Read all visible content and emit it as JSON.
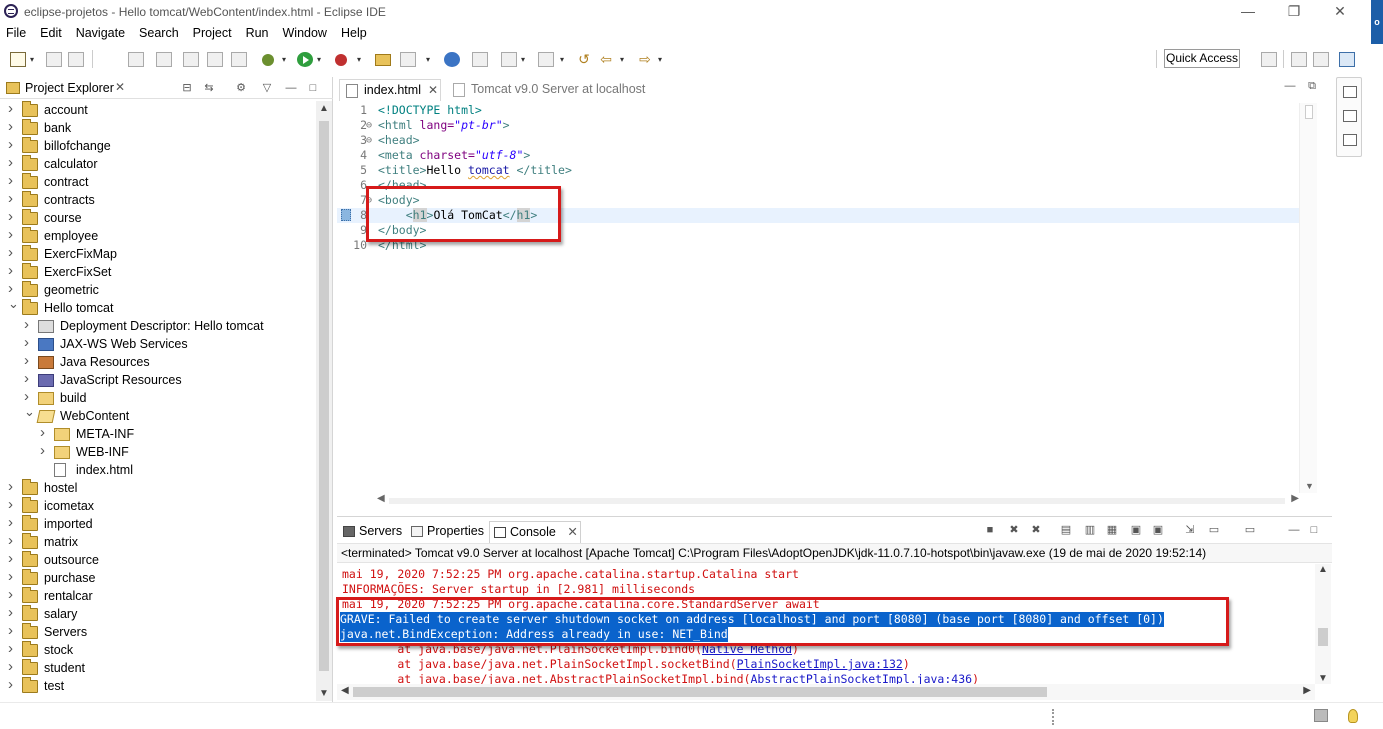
{
  "window": {
    "title": "eclipse-projetos - Hello tomcat/WebContent/index.html - Eclipse IDE",
    "minimize": "—",
    "restore": "❐",
    "close": "✕"
  },
  "menu": [
    "File",
    "Edit",
    "Navigate",
    "Search",
    "Project",
    "Run",
    "Window",
    "Help"
  ],
  "toolbar": {
    "quick_access": "Quick Access"
  },
  "explorer": {
    "title": "Project Explorer",
    "close": "✕",
    "items": [
      {
        "label": "account",
        "depth": 0,
        "expanded": false,
        "icon": "project-icon"
      },
      {
        "label": "bank",
        "depth": 0,
        "expanded": false,
        "icon": "project-icon"
      },
      {
        "label": "billofchange",
        "depth": 0,
        "expanded": false,
        "icon": "project-icon"
      },
      {
        "label": "calculator",
        "depth": 0,
        "expanded": false,
        "icon": "project-icon"
      },
      {
        "label": "contract",
        "depth": 0,
        "expanded": false,
        "icon": "project-icon"
      },
      {
        "label": "contracts",
        "depth": 0,
        "expanded": false,
        "icon": "project-icon"
      },
      {
        "label": "course",
        "depth": 0,
        "expanded": false,
        "icon": "project-icon"
      },
      {
        "label": "employee",
        "depth": 0,
        "expanded": false,
        "icon": "project-icon"
      },
      {
        "label": "ExercFixMap",
        "depth": 0,
        "expanded": false,
        "icon": "project-icon"
      },
      {
        "label": "ExercFixSet",
        "depth": 0,
        "expanded": false,
        "icon": "project-icon"
      },
      {
        "label": "geometric",
        "depth": 0,
        "expanded": false,
        "icon": "project-icon"
      },
      {
        "label": "Hello tomcat",
        "depth": 0,
        "expanded": true,
        "icon": "project-icon"
      },
      {
        "label": "Deployment Descriptor: Hello tomcat",
        "depth": 1,
        "expanded": false,
        "icon": "deployment-descriptor-icon"
      },
      {
        "label": "JAX-WS Web Services",
        "depth": 1,
        "expanded": false,
        "icon": "web-services-icon"
      },
      {
        "label": "Java Resources",
        "depth": 1,
        "expanded": false,
        "icon": "java-resources-icon"
      },
      {
        "label": "JavaScript Resources",
        "depth": 1,
        "expanded": false,
        "icon": "javascript-resources-icon"
      },
      {
        "label": "build",
        "depth": 1,
        "expanded": false,
        "icon": "folder-icon"
      },
      {
        "label": "WebContent",
        "depth": 1,
        "expanded": true,
        "icon": "open-folder-icon"
      },
      {
        "label": "META-INF",
        "depth": 2,
        "expanded": false,
        "icon": "folder-icon"
      },
      {
        "label": "WEB-INF",
        "depth": 2,
        "expanded": false,
        "icon": "folder-icon"
      },
      {
        "label": "index.html",
        "depth": 2,
        "expanded": null,
        "icon": "html-file-icon"
      },
      {
        "label": "hostel",
        "depth": 0,
        "expanded": false,
        "icon": "project-icon"
      },
      {
        "label": "icometax",
        "depth": 0,
        "expanded": false,
        "icon": "project-icon"
      },
      {
        "label": "imported",
        "depth": 0,
        "expanded": false,
        "icon": "project-icon"
      },
      {
        "label": "matrix",
        "depth": 0,
        "expanded": false,
        "icon": "project-icon"
      },
      {
        "label": "outsource",
        "depth": 0,
        "expanded": false,
        "icon": "project-icon"
      },
      {
        "label": "purchase",
        "depth": 0,
        "expanded": false,
        "icon": "project-icon"
      },
      {
        "label": "rentalcar",
        "depth": 0,
        "expanded": false,
        "icon": "project-icon"
      },
      {
        "label": "salary",
        "depth": 0,
        "expanded": false,
        "icon": "project-icon"
      },
      {
        "label": "Servers",
        "depth": 0,
        "expanded": false,
        "icon": "project-icon"
      },
      {
        "label": "stock",
        "depth": 0,
        "expanded": false,
        "icon": "project-icon"
      },
      {
        "label": "student",
        "depth": 0,
        "expanded": false,
        "icon": "project-icon"
      },
      {
        "label": "test",
        "depth": 0,
        "expanded": false,
        "icon": "project-icon"
      }
    ]
  },
  "editor": {
    "tabs": [
      {
        "label": "index.html",
        "active": true
      },
      {
        "label": "Tomcat v9.0 Server at localhost",
        "active": false
      }
    ],
    "current_line": 8,
    "lines": [
      {
        "n": "1",
        "fold": "",
        "parts": [
          [
            "doc",
            "<!DOCTYPE html>"
          ]
        ]
      },
      {
        "n": "2",
        "fold": "⊖",
        "parts": [
          [
            "tag",
            "<html "
          ],
          [
            "attr",
            "lang="
          ],
          [
            "val",
            "\"pt-br\""
          ],
          [
            "tag",
            ">"
          ]
        ]
      },
      {
        "n": "3",
        "fold": "⊖",
        "parts": [
          [
            "tag",
            "<head>"
          ]
        ]
      },
      {
        "n": "4",
        "fold": "",
        "parts": [
          [
            "tag",
            "<meta "
          ],
          [
            "attr",
            "charset="
          ],
          [
            "val",
            "\"utf-8\""
          ],
          [
            "tag",
            ">"
          ]
        ]
      },
      {
        "n": "5",
        "fold": "",
        "parts": [
          [
            "tag",
            "<title>"
          ],
          [
            "plain",
            "Hello "
          ],
          [
            "sq",
            "tomcat"
          ],
          [
            "plain",
            " "
          ],
          [
            "tag",
            "</title>"
          ]
        ]
      },
      {
        "n": "6",
        "fold": "",
        "parts": [
          [
            "tag",
            "</head>"
          ]
        ]
      },
      {
        "n": "7",
        "fold": "⊖",
        "parts": [
          [
            "tag",
            "<body>"
          ]
        ]
      },
      {
        "n": "8",
        "fold": "",
        "parts": [
          [
            "plain",
            "    "
          ],
          [
            "tag",
            "<"
          ],
          [
            "tagbox",
            "h1"
          ],
          [
            "tag",
            ">"
          ],
          [
            "plain",
            "Olá TomCat"
          ],
          [
            "tag",
            "</"
          ],
          [
            "tagbox",
            "h1"
          ],
          [
            "tag",
            ">"
          ]
        ]
      },
      {
        "n": "9",
        "fold": "",
        "parts": [
          [
            "tag",
            "</body>"
          ]
        ]
      },
      {
        "n": "10",
        "fold": "",
        "parts": [
          [
            "tag",
            "</html>"
          ]
        ]
      }
    ]
  },
  "console": {
    "tabs": [
      {
        "label": "Servers",
        "active": false
      },
      {
        "label": "Properties",
        "active": false
      },
      {
        "label": "Console",
        "active": true
      }
    ],
    "header": "<terminated> Tomcat v9.0 Server at localhost [Apache Tomcat] C:\\Program Files\\AdoptOpenJDK\\jdk-11.0.7.10-hotspot\\bin\\javaw.exe (19 de mai de 2020 19:52:14)",
    "lines": [
      {
        "text": "mai 19, 2020 7:52:25 PM org.apache.catalina.startup.Catalina start",
        "selected": false
      },
      {
        "text": "INFORMAÇÕES: Server startup in [2.981] milliseconds",
        "selected": false
      },
      {
        "text": "mai 19, 2020 7:52:25 PM org.apache.catalina.core.StandardServer await",
        "selected": false
      },
      {
        "text": "GRAVE: Failed to create server shutdown socket on address [localhost] and port [8080] (base port [8080] and offset [0])",
        "selected": true
      },
      {
        "text": "java.net.BindException: Address already in use: NET_Bind",
        "selected": true
      },
      {
        "text": "        at java.base/java.net.PlainSocketImpl.bind0(Native Method)",
        "selected": false,
        "link": "Native Method"
      },
      {
        "text": "        at java.base/java.net.PlainSocketImpl.socketBind(PlainSocketImpl.java:132)",
        "selected": false,
        "link": "PlainSocketImpl.java:132"
      },
      {
        "text": "        at java.base/java.net.AbstractPlainSocketImpl.bind(AbstractPlainSocketImpl.java:436)",
        "selected": false,
        "link": "AbstractPlainSocketImpl.java:436"
      }
    ]
  },
  "colors": {
    "highlight_box": "#d61a1a",
    "selection": "#0a63cc",
    "console_error": "#d01010"
  }
}
